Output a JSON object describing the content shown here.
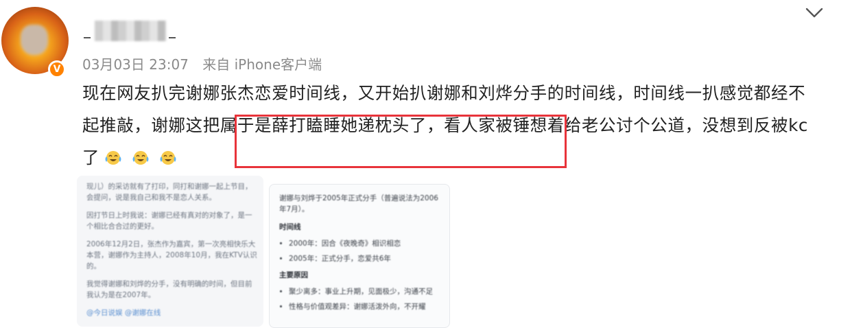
{
  "post": {
    "author": {
      "name_masked": "_ ________ _",
      "verified_badge": "V"
    },
    "timestamp": "03月03日 23:07",
    "source": "来自 iPhone客户端",
    "text_before_highlight": "现在网友扒完谢娜张杰恋爱时间线，又开始扒谢娜和刘烨分手的时间线，时间线一扒感觉都经不起推敲，",
    "text_highlight": "谢娜这把属于是薛打瞌睡她递枕头了，",
    "text_after_highlight": "看人家被锤想着给老公讨个公道，没想到反被kc了",
    "emojis": [
      "laugh-cry-icon",
      "laugh-cry-icon",
      "laugh-cry-icon"
    ],
    "highlight_color": "#e8333a"
  },
  "image1": {
    "paragraphs": [
      "现儿）的采访就有了打印，同打和谢娜一起上节目，会提问，说是我自己和我不是恋人关系。",
      "因打节日上时我说：谢娜已经有真对的对象了，是一个相比合合过的更好。",
      "2006年12月2日，张杰作为嘉宾，第一次亮相快乐大本营，谢娜作为主持人，2008年10月，我在KTV认识的。",
      "我觉得谢娜和刘烨的分手，没有明确的时间，但目前我认为是在2007年。"
    ],
    "link": "@今日说娱 @谢娜在线",
    "bullets_hint": ""
  },
  "image2": {
    "intro": "谢娜与刘烨于2005年正式分手（普遍说法为2006年7月）。",
    "section1_title": "时间线",
    "section1_items": [
      "2000年：因合《夜晚奇》相识相恋",
      "2005年：正式分手，恋爱共6年"
    ],
    "section2_title": "主要原因",
    "section2_items": [
      "聚少离多：事业上升期，见面极少，沟通不足",
      "性格与价值观差异：谢娜活泼外向，不开耀"
    ]
  },
  "ui": {
    "more_icon": "chevron-down-icon"
  }
}
